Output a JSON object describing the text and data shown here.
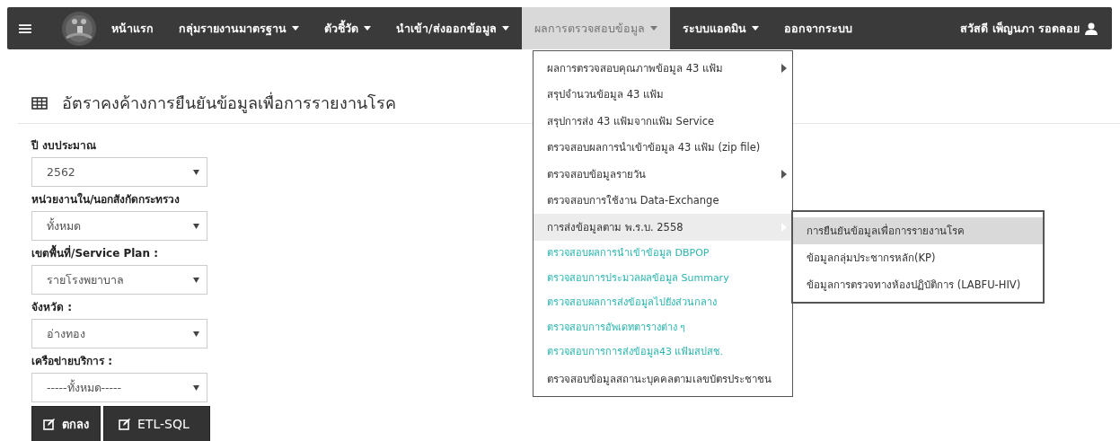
{
  "navbar": {
    "menu_icon": "≡",
    "items": [
      {
        "label": "หน้าแรก",
        "dropdown": false,
        "selected": false
      },
      {
        "label": "กลุ่มรายงานมาตรฐาน",
        "dropdown": true,
        "selected": false
      },
      {
        "label": "ตัวชี้วัด",
        "dropdown": true,
        "selected": false
      },
      {
        "label": "นำเข้า/ส่งออกข้อมูล",
        "dropdown": true,
        "selected": false
      },
      {
        "label": "ผลการตรวจสอบข้อมูล",
        "dropdown": true,
        "selected": true
      },
      {
        "label": "ระบบแอดมิน",
        "dropdown": true,
        "selected": false
      },
      {
        "label": "ออกจากระบบ",
        "dropdown": false,
        "selected": false
      }
    ],
    "user": "สวัสดี เพ็ญนภา รอดลอย"
  },
  "page": {
    "title": "อัตราคงค้างการยืนยันข้อมูลเพื่อการรายงานโรค",
    "fields": [
      {
        "label": "ปี งบประมาณ",
        "value": "2562"
      },
      {
        "label": "หน่วยงานใน/นอกสังกัดกระทรวง",
        "value": "ทั้งหมด"
      },
      {
        "label": "เขตพื้นที่/Service Plan :",
        "value": "รายโรงพยาบาล"
      },
      {
        "label": "จังหวัด :",
        "value": "อ่างทอง"
      },
      {
        "label": "เครือข่ายบริการ :",
        "value": "-----ทั้งหมด-----"
      }
    ],
    "buttons": [
      "ตกลง",
      "ETL-SQL"
    ]
  },
  "dropdown_menu": {
    "items": [
      {
        "label": "ผลการตรวจสอบคุณภาพข้อมูล 43 แฟ้ม",
        "kind": "normal",
        "has_submenu": true,
        "selected": false
      },
      {
        "label": "สรุปจำนวนข้อมูล 43 แฟ้ม",
        "kind": "normal",
        "has_submenu": false,
        "selected": false
      },
      {
        "label": "สรุปการส่ง 43 แฟ้มจากแฟ้ม Service",
        "kind": "normal",
        "has_submenu": false,
        "selected": false
      },
      {
        "label": "ตรวจสอบผลการนำเข้าข้อมูล 43 แฟ้ม (zip file)",
        "kind": "normal",
        "has_submenu": false,
        "selected": false
      },
      {
        "label": "ตรวจสอบข้อมูลรายวัน",
        "kind": "normal",
        "has_submenu": true,
        "selected": false
      },
      {
        "label": "ตรวจสอบการใช้งาน Data-Exchange",
        "kind": "normal",
        "has_submenu": false,
        "selected": false
      },
      {
        "label": "การส่งข้อมูลตาม พ.ร.บ. 2558",
        "kind": "normal",
        "has_submenu": true,
        "selected": true
      },
      {
        "label": "ตรวจสอบผลการนำเข้าข้อมูล DBPOP",
        "kind": "link",
        "has_submenu": false,
        "selected": false
      },
      {
        "label": "ตรวจสอบการประมวลผลข้อมูล Summary",
        "kind": "link",
        "has_submenu": false,
        "selected": false
      },
      {
        "label": "ตรวจสอบผลการส่งข้อมูลไปยังส่วนกลาง",
        "kind": "link",
        "has_submenu": false,
        "selected": false
      },
      {
        "label": "ตรวจสอบการอัพเดทตารางต่าง ๆ",
        "kind": "link",
        "has_submenu": false,
        "selected": false
      },
      {
        "label": "ตรวจสอบการการส่งข้อมูล43 แฟ้มสปสช.",
        "kind": "link",
        "has_submenu": false,
        "selected": false
      },
      {
        "label": "ตรวจสอบข้อมูลสถานะบุคคลตามเลขบัตรประชาชน",
        "kind": "normal",
        "has_submenu": false,
        "selected": false
      }
    ]
  },
  "submenu": {
    "items": [
      {
        "label": "การยืนยันข้อมูลเพื่อการรายงานโรค",
        "selected": true
      },
      {
        "label": "ข้อมูลกลุ่มประชากรหลัก(KP)",
        "selected": false
      },
      {
        "label": "ข้อมูลการตรวจทางห้องปฏิบัติการ (LABFU-HIV)",
        "selected": false
      }
    ]
  }
}
